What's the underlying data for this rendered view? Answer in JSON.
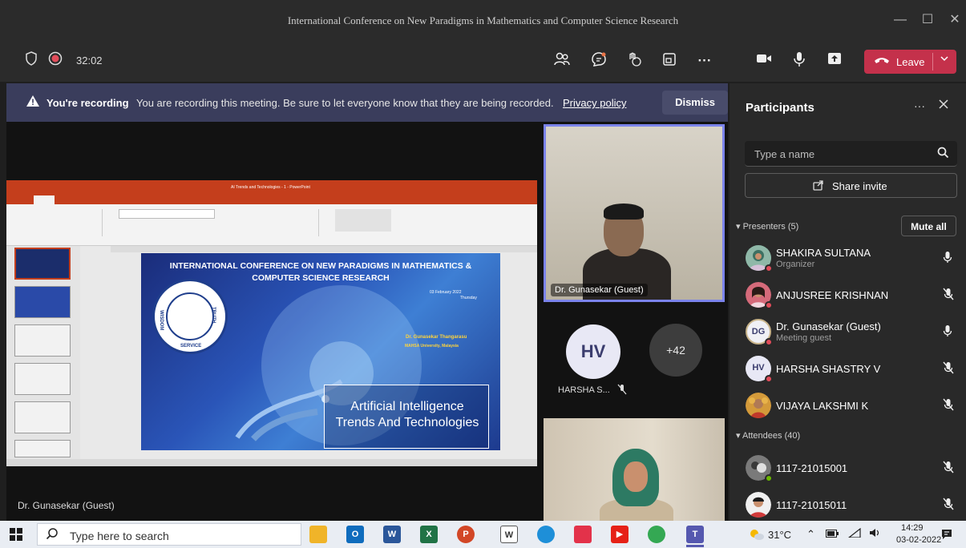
{
  "window": {
    "title": "International Conference on New Paradigms in Mathematics and Computer Science Research",
    "minimize": "—",
    "maximize": "☐",
    "close": "✕"
  },
  "toolbar": {
    "timer": "32:02",
    "leave_label": "Leave",
    "more": "···"
  },
  "banner": {
    "strong": "You're recording",
    "message": "You are recording this meeting. Be sure to let everyone know that they are being recorded.",
    "link": "Privacy policy",
    "dismiss": "Dismiss"
  },
  "slide": {
    "title_line1": "INTERNATIONAL CONFERENCE ON NEW PARADIGMS IN MATHEMATICS &",
    "title_line2": "COMPUTER SCIENCE RESEARCH",
    "date": "03 February 2022",
    "day": "Thursday",
    "speaker": "Dr. Gunasekar Thangarasu",
    "university": "MAHSA University, Malaysia",
    "seal_left": "WISDOM",
    "seal_right": "TRUTH",
    "seal_bottom": "SERVICE",
    "box_line1": "Artificial Intelligence",
    "box_line2": "Trends And Technologies",
    "ppt_title": "AI Trends and Technologies - 1 - PowerPoint"
  },
  "stage": {
    "presenter_label": "Dr. Gunasekar (Guest)"
  },
  "tiles": {
    "main_label": "Dr. Gunasekar (Guest)",
    "hv_initials": "HV",
    "hv_name": "HARSHA S...",
    "more_count": "+42"
  },
  "panel": {
    "title": "Participants",
    "search_placeholder": "Type a name",
    "share_invite": "Share invite",
    "presenters_header": "Presenters (5)",
    "mute_all": "Mute all",
    "attendees_header": "Attendees (40)",
    "presenters": [
      {
        "name": "SHAKIRA SULTANA",
        "role": "Organizer"
      },
      {
        "name": "ANJUSREE KRISHNAN",
        "role": ""
      },
      {
        "name": "Dr. Gunasekar (Guest)",
        "role": "Meeting guest",
        "initials": "DG"
      },
      {
        "name": "HARSHA SHASTRY V",
        "role": "",
        "initials": "HV"
      },
      {
        "name": "VIJAYA LAKSHMI K",
        "role": ""
      }
    ],
    "attendees": [
      {
        "name": "1117-21015001"
      },
      {
        "name": "1117-21015011"
      }
    ]
  },
  "taskbar": {
    "search_placeholder": "Type here to search",
    "temperature": "31°C",
    "time": "14:29",
    "date": "03-02-2022"
  },
  "colors": {
    "leave": "#c4314b",
    "banner": "#3a3d5c",
    "accent": "#7b83eb",
    "panel": "#292929"
  }
}
